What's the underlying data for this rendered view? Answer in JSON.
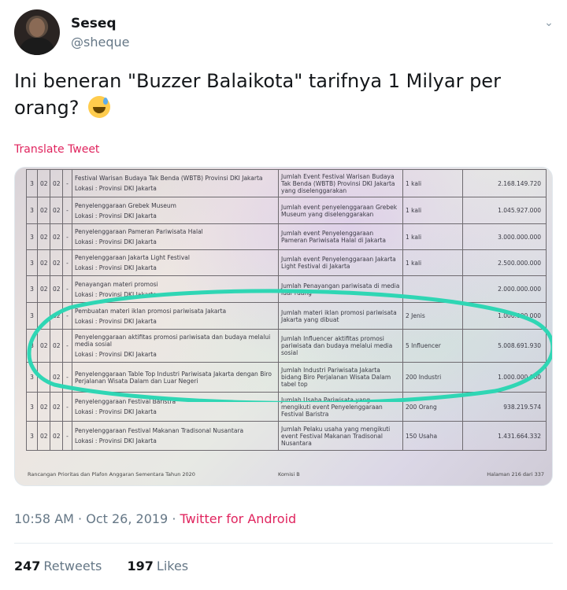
{
  "author": {
    "display_name": "Seseq",
    "handle": "@sheque"
  },
  "tweet": {
    "text": "Ini beneran \"Buzzer Balaikota\" tarifnya 1 Milyar per orang?",
    "emoji": "sweat-smile-emoji",
    "translate_label": "Translate Tweet"
  },
  "document": {
    "rows": [
      {
        "c1": "3",
        "c2": "02",
        "c3": "02",
        "c4": "-",
        "program": "Festival Warisan Budaya Tak Benda (WBTB) Provinsi DKI Jakarta",
        "location": "Lokasi : Provinsi DKI Jakarta",
        "indicator": "Jumlah Event Festival Warisan Budaya Tak Benda (WBTB) Provinsi DKI Jakarta yang diselenggarakan",
        "target": "1 kali",
        "amount": "2.168.149.720"
      },
      {
        "c1": "3",
        "c2": "02",
        "c3": "02",
        "c4": "-",
        "program": "Penyelenggaraan Grebek Museum",
        "location": "Lokasi : Provinsi DKI Jakarta",
        "indicator": "Jumlah event penyelenggaraan Grebek Museum yang diselenggarakan",
        "target": "1 kali",
        "amount": "1.045.927.000"
      },
      {
        "c1": "3",
        "c2": "02",
        "c3": "02",
        "c4": "-",
        "program": "Penyelenggaraan Pameran Pariwisata Halal",
        "location": "Lokasi : Provinsi DKI Jakarta",
        "indicator": "Jumlah event Penyelenggaraan Pameran Pariwisata Halal di Jakarta",
        "target": "1 kali",
        "amount": "3.000.000.000"
      },
      {
        "c1": "3",
        "c2": "02",
        "c3": "02",
        "c4": "-",
        "program": "Penyelenggaraan Jakarta Light Festival",
        "location": "Lokasi : Provinsi DKI Jakarta",
        "indicator": "Jumlah event Penyelenggaraan Jakarta Light Festival di Jakarta",
        "target": "1 kali",
        "amount": "2.500.000.000"
      },
      {
        "c1": "3",
        "c2": "02",
        "c3": "02",
        "c4": "-",
        "program": "Penayangan materi promosi",
        "location": "Lokasi : Provinsi DKI Jakarta",
        "indicator": "Jumlah Penayangan pariwisata di media luar ruang",
        "target": "",
        "amount": "2.000.000.000"
      },
      {
        "c1": "3",
        "c2": "",
        "c3": "02",
        "c4": "-",
        "program": "Pembuatan materi iklan promosi pariwisata Jakarta",
        "location": "Lokasi : Provinsi DKI Jakarta",
        "indicator": "Jumlah materi iklan promosi pariwisata Jakarta yang dibuat",
        "target": "2 Jenis",
        "amount": "1.000.000.000"
      },
      {
        "c1": "3",
        "c2": "02",
        "c3": "02",
        "c4": "-",
        "program": "Penyelenggaraan aktifitas promosi pariwisata dan budaya melalui media sosial",
        "location": "Lokasi : Provinsi DKI Jakarta",
        "indicator": "Jumlah Influencer aktifitas promosi pariwisata dan budaya melalui media sosial",
        "target": "5 Influencer",
        "amount": "5.008.691.930"
      },
      {
        "c1": "3",
        "c2": "",
        "c3": "02",
        "c4": "-",
        "program": "Penyelenggaraan Table Top Industri Pariwisata Jakarta dengan Biro Perjalanan Wisata Dalam dan Luar Negeri",
        "location": "",
        "indicator": "Jumlah Industri Pariwisata Jakarta bidang Biro Perjalanan Wisata Dalam tabel top",
        "target": "200 Industri",
        "amount": "1.000.000.000"
      },
      {
        "c1": "3",
        "c2": "02",
        "c3": "02",
        "c4": "-",
        "program": "Penyelenggaraan Festival Baristra",
        "location": "Lokasi : Provinsi DKI Jakarta",
        "indicator": "Jumlah Usaha Pariwisata yang mengikuti event Penyelenggaraan Festival Baristra",
        "target": "200 Orang",
        "amount": "938.219.574"
      },
      {
        "c1": "3",
        "c2": "02",
        "c3": "02",
        "c4": "-",
        "program": "Penyelenggaraan Festival Makanan Tradisonal Nusantara",
        "location": "Lokasi : Provinsi DKI Jakarta",
        "indicator": "Jumlah Pelaku usaha yang mengikuti event Festival Makanan Tradisonal Nusantara",
        "target": "150 Usaha",
        "amount": "1.431.664.332"
      }
    ],
    "footer_left": "Rancangan Prioritas dan Plafon Anggaran Sementara Tahun 2020",
    "footer_center": "Komisi B",
    "footer_right": "Halaman 216 dari 337",
    "highlight_color": "#2fd6b4"
  },
  "meta": {
    "time": "10:58 AM",
    "separator": "·",
    "date": "Oct 26, 2019",
    "source": "Twitter for Android"
  },
  "stats": {
    "retweets_count": "247",
    "retweets_label": "Retweets",
    "likes_count": "197",
    "likes_label": "Likes"
  },
  "colors": {
    "link_pink": "#e0245e",
    "muted": "#657786"
  }
}
